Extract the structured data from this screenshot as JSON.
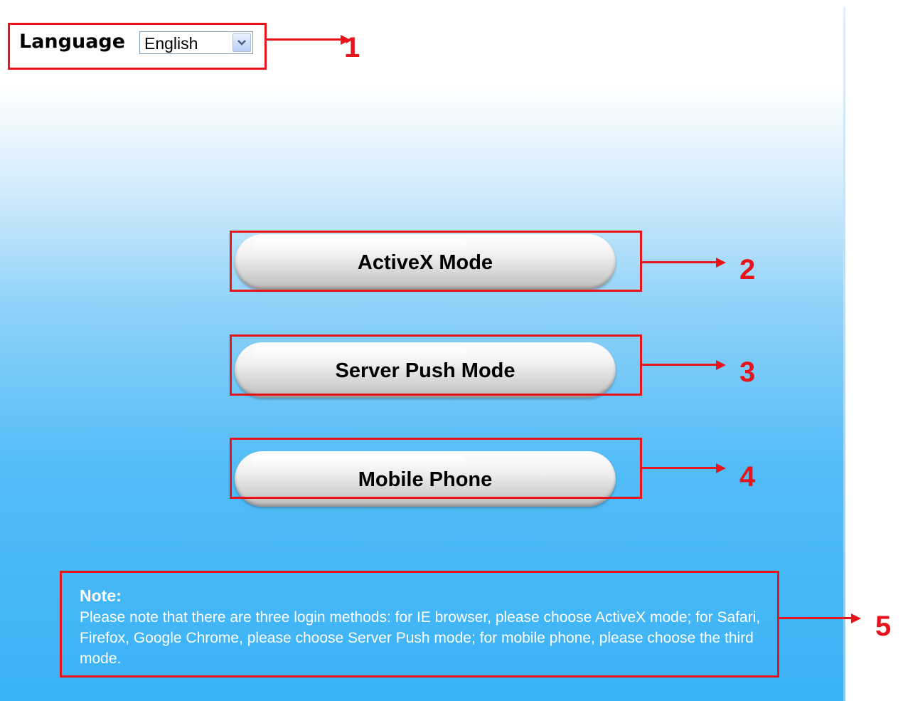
{
  "language": {
    "label": "Language",
    "selected": "English"
  },
  "modes": {
    "activex": "ActiveX Mode",
    "server_push": "Server Push Mode",
    "mobile": "Mobile Phone"
  },
  "note": {
    "title": "Note:",
    "text": "Please note that there are three login methods: for IE browser, please choose ActiveX mode; for Safari, Firefox, Google Chrome, please choose Server Push mode; for mobile phone, please choose the third mode."
  },
  "callouts": [
    "1",
    "2",
    "3",
    "4",
    "5"
  ],
  "colors": {
    "annotation": "#e8141c",
    "background_bottom": "#3ab2f6",
    "note_text": "#ffffff"
  },
  "icons": {
    "dropdown": "chevron-down-icon"
  }
}
